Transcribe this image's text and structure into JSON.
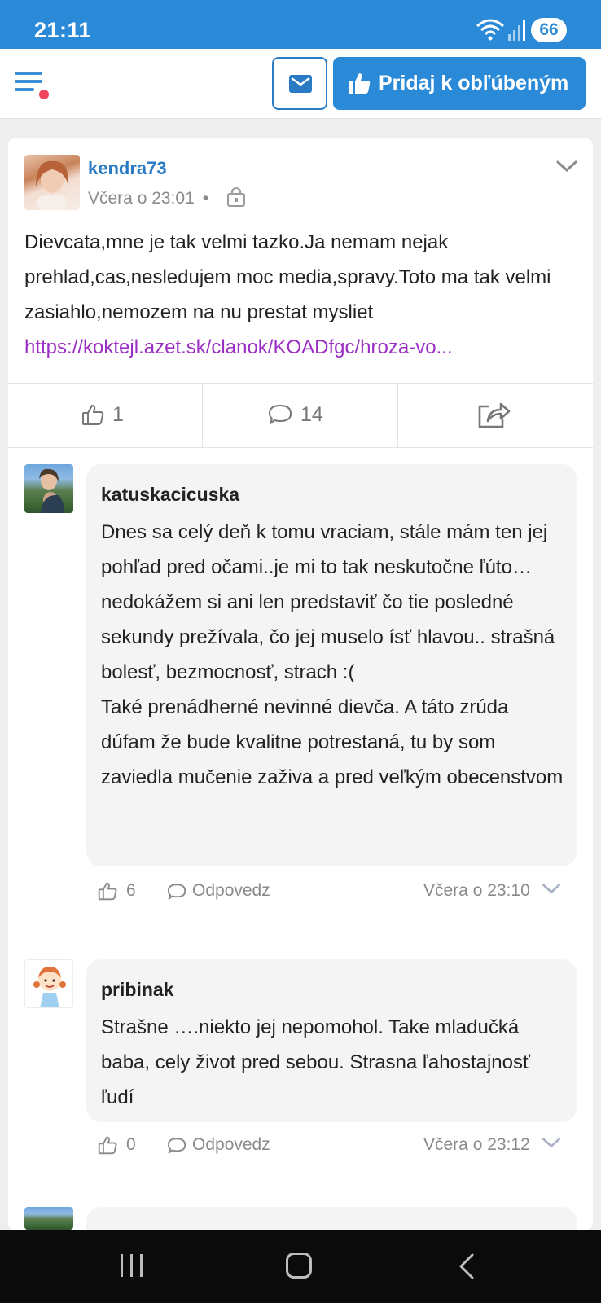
{
  "status_bar": {
    "time": "21:11",
    "battery": "66"
  },
  "header": {
    "favorite_label": "Pridaj k obľúbeným"
  },
  "post": {
    "author": "kendra73",
    "time": "Včera o 23:01",
    "separator": "•",
    "text": "Dievcata,mne je tak velmi tazko.Ja nemam nejak prehlad,cas,nesledujem moc media,spravy.Toto ma tak velmi zasiahlo,nemozem na nu prestat mysliet",
    "link": "https://koktejl.azet.sk/clanok/KOADfgc/hroza-vo...",
    "likes": "1",
    "comments": "14"
  },
  "comments": [
    {
      "author": "katuskacicuska",
      "text": "Dnes sa celý deň k tomu vraciam, stále mám ten jej pohľad pred očami..je mi to tak neskutočne ľúto…nedokážem si ani len predstaviť čo tie posledné sekundy prežívala, čo jej muselo ísť hlavou.. strašná bolesť, bezmocnosť, strach :(\nTaké prenádherné nevinné dievča. A táto zrúda dúfam že bude kvalitne potrestaná, tu by som zaviedla mučenie zaživa a pred veľkým obecenstvom",
      "likes": "6",
      "reply_label": "Odpovedz",
      "time": "Včera o 23:10"
    },
    {
      "author": "pribinak",
      "text": "Strašne ….niekto jej nepomohol. Take mladučká baba, cely život pred sebou. Strasna ľahostajnosť ľudí",
      "likes": "0",
      "reply_label": "Odpovedz",
      "time": "Včera o 23:12"
    }
  ],
  "colors": {
    "brand_blue": "#2a8ad8",
    "link_purple": "#9b2fc4",
    "notification_dot": "#f2445c"
  }
}
